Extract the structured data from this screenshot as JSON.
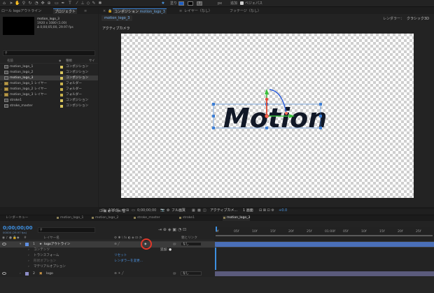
{
  "toolbar": {
    "fill_label": "塗り",
    "px_label": "px",
    "add_label": "追加",
    "bezier_label": "ベジェパス",
    "fill_color": "#1e5fc4",
    "stroke_color": "#000000"
  },
  "project": {
    "tab_title": "プロジェクト",
    "tab_prev": "ロール logoアウトライン",
    "item_name": "motion_logo_3",
    "item_info_1": "1920 x 1080 (1.00)",
    "item_info_2": "Δ 0;00;05;00, 29.97 fps",
    "search_placeholder": "",
    "columns": {
      "name": "名前",
      "type": "種類",
      "size": "サイ"
    },
    "items": [
      {
        "name": "motion_logo_1",
        "type": "コンポジション",
        "kind": "comp"
      },
      {
        "name": "motion_logo_2",
        "type": "コンポジション",
        "kind": "comp"
      },
      {
        "name": "motion_logo_3",
        "type": "コンポジション",
        "kind": "comp",
        "selected": true
      },
      {
        "name": "motion_logo_1 レイヤー",
        "type": "フォルダー",
        "kind": "folder"
      },
      {
        "name": "motion_logo_2 レイヤー",
        "type": "フォルダー",
        "kind": "folder"
      },
      {
        "name": "motion_logo_3 レイヤー",
        "type": "フォルダー",
        "kind": "folder"
      },
      {
        "name": "stroke1",
        "type": "コンポジション",
        "kind": "comp"
      },
      {
        "name": "stroke_master",
        "type": "コンポジション",
        "kind": "comp"
      }
    ]
  },
  "comp": {
    "panel_tab": "コンポジション",
    "comp_name": "motion_logo_3",
    "layer_tab": "レイヤー（なし）",
    "footage_tab": "フッテージ（なし）",
    "render_label": "レンダラー：",
    "render_value": "クラシック3D",
    "active_tab": "motion_logo_3",
    "view_label": "アクティブカメラ",
    "logo_text": "Motion"
  },
  "viewer": {
    "bpc": "8 bpc",
    "zoom": "100 %",
    "timecode": "0;00;00;00",
    "quality": "フル画質",
    "camera": "アクティブカメ...",
    "views": "1 画面",
    "exposure": "+0.0"
  },
  "timeline": {
    "tabs": [
      {
        "label": "レンダーキュー",
        "active": false
      },
      {
        "label": "motion_logo_1",
        "active": false
      },
      {
        "label": "motion_logo_2",
        "active": false
      },
      {
        "label": "stroke_master",
        "active": false
      },
      {
        "label": "stroke1",
        "active": false
      },
      {
        "label": "motion_logo_3",
        "active": true
      }
    ],
    "timecode": "0;00;00;00",
    "fps": "00000 (29.97 fps)",
    "header": {
      "layer_name": "レイヤー名",
      "parent": "親とリンク"
    },
    "ruler": [
      "0f",
      "05f",
      "10f",
      "15f",
      "20f",
      "25f",
      "01:00f",
      "05f",
      "10f",
      "15f",
      "20f",
      "25f"
    ],
    "layers": [
      {
        "num": "1",
        "name": "logoアウトライン",
        "parent": "なし",
        "selected": true
      },
      {
        "num": "2",
        "name": "logo",
        "parent": "なし",
        "selected": false
      }
    ],
    "sub": {
      "contents": "コンテンツ",
      "add": "追加:",
      "transform": "トランスフォーム",
      "reset": "リセット",
      "geometry": "形状オプション",
      "renderer": "レンダラーを変更...",
      "material": "マテリアルオプション"
    }
  }
}
